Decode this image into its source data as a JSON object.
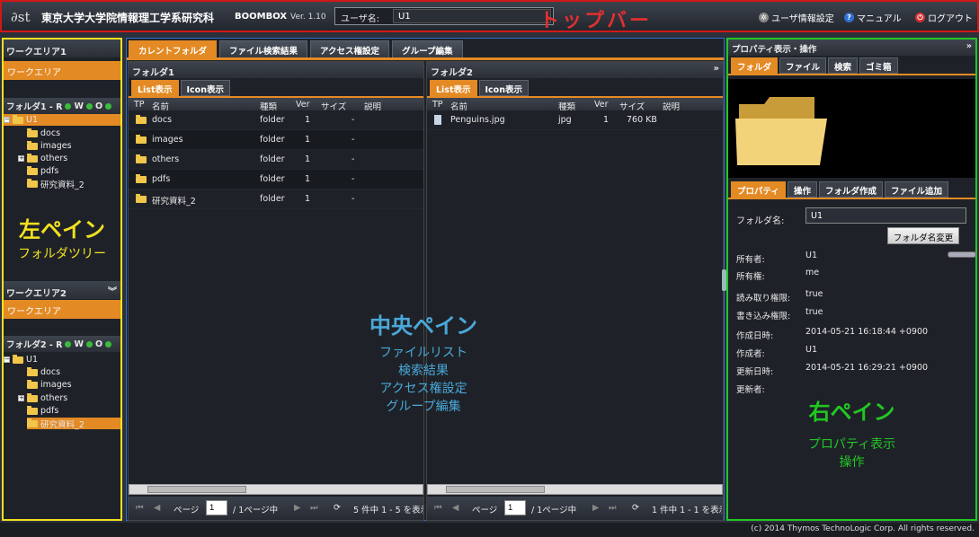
{
  "topbar": {
    "logo": "∂st",
    "org": "東京大学大学院情報理工学系研究科",
    "app": "BOOMBOX",
    "version": "Ver. 1.10",
    "user_label": "ユーザ名:",
    "user_value": "U1",
    "annotation": "トップバー",
    "links": [
      "ユーザ情報設定",
      "マニュアル",
      "ログアウト"
    ]
  },
  "left": {
    "workarea1": "ワークエリア1",
    "workarea1_bar": "ワークエリア",
    "folder1_title": "フォルダ1 - R",
    "workarea2": "ワークエリア2",
    "workarea2_bar": "ワークエリア",
    "folder2_title": "フォルダ2 - R",
    "perm_w": "W",
    "perm_o": "O",
    "tree1": [
      "U1",
      "docs",
      "images",
      "others",
      "pdfs",
      "研究資料_2"
    ],
    "tree2": [
      "U1",
      "docs",
      "images",
      "others",
      "pdfs",
      "研究資料_2"
    ],
    "annotation_title": "左ペイン",
    "annotation_sub": "フォルダツリー"
  },
  "center": {
    "tabs": [
      "カレントフォルダ",
      "ファイル検索結果",
      "アクセス権設定",
      "グループ編集"
    ],
    "pane1": {
      "title": "フォルダ1",
      "subtabs": [
        "List表示",
        "Icon表示"
      ],
      "columns": [
        "TP",
        "名前",
        "種類",
        "Ver",
        "サイズ",
        "説明"
      ],
      "rows": [
        [
          "docs",
          "folder",
          "1",
          "-"
        ],
        [
          "images",
          "folder",
          "1",
          "-"
        ],
        [
          "others",
          "folder",
          "1",
          "-"
        ],
        [
          "pdfs",
          "folder",
          "1",
          "-"
        ],
        [
          "研究資料_2",
          "folder",
          "1",
          "-"
        ]
      ],
      "page_label": "ページ",
      "page_value": "1",
      "page_total": "/ 1ページ中",
      "count": "5 件中 1 - 5 を表示"
    },
    "pane2": {
      "title": "フォルダ2",
      "subtabs": [
        "List表示",
        "Icon表示"
      ],
      "columns": [
        "TP",
        "名前",
        "種類",
        "Ver",
        "サイズ",
        "説明"
      ],
      "rows": [
        [
          "Penguins.jpg",
          "jpg",
          "1",
          "760 KB"
        ]
      ],
      "page_label": "ページ",
      "page_value": "1",
      "page_total": "/ 1ページ中",
      "count": "1 件中 1 - 1 を表示"
    },
    "annotation": [
      "中央ペイン",
      "ファイルリスト",
      "検索結果",
      "アクセス権設定",
      "グループ編集"
    ]
  },
  "right": {
    "title": "プロパティ表示・操作",
    "tabs": [
      "フォルダ",
      "ファイル",
      "検索",
      "ゴミ箱"
    ],
    "tabs2": [
      "プロパティ",
      "操作",
      "フォルダ作成",
      "ファイル追加"
    ],
    "folder_name_label": "フォルダ名:",
    "folder_name_value": "U1",
    "rename_button": "フォルダ名変更",
    "props": [
      [
        "所有者:",
        "U1"
      ],
      [
        "所有権:",
        "me"
      ],
      [
        "読み取り権限:",
        "true"
      ],
      [
        "書き込み権限:",
        "true"
      ],
      [
        "作成日時:",
        "2014-05-21 16:18:44 +0900"
      ],
      [
        "作成者:",
        "U1"
      ],
      [
        "更新日時:",
        "2014-05-21 16:29:21 +0900"
      ],
      [
        "更新者:",
        ""
      ]
    ],
    "annotation": [
      "右ペイン",
      "プロパティ表示",
      "操作"
    ]
  },
  "footer": "(c) 2014 Thymos TechnoLogic Corp. All rights reserved."
}
